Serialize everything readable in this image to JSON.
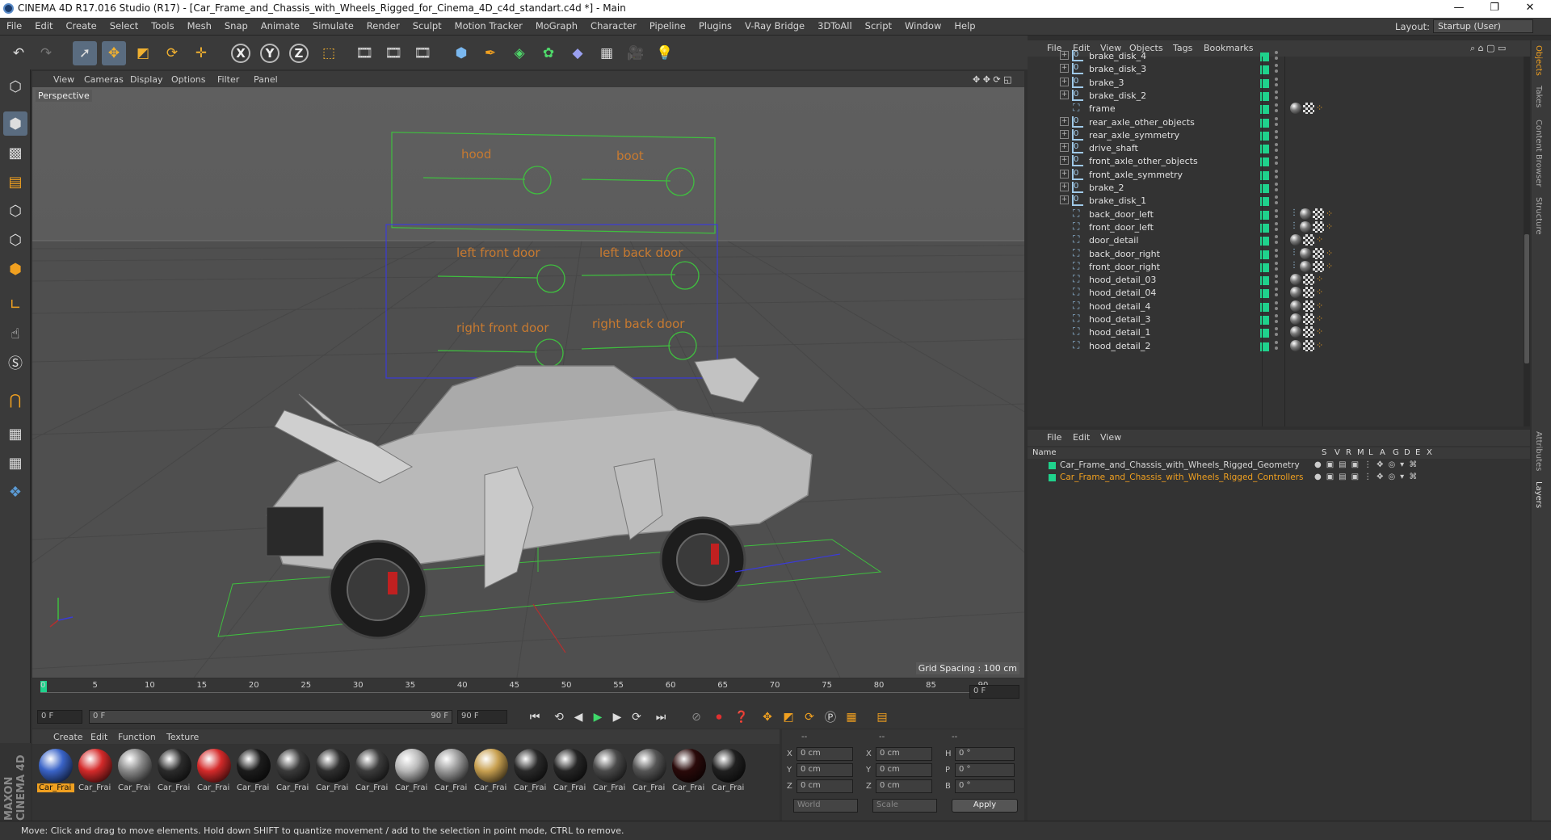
{
  "window": {
    "title": "CINEMA 4D R17.016 Studio (R17) - [Car_Frame_and_Chassis_with_Wheels_Rigged_for_Cinema_4D_c4d_standart.c4d *] - Main",
    "minimize": "—",
    "maximize": "❐",
    "close": "✕"
  },
  "menubar": {
    "items": [
      "File",
      "Edit",
      "Create",
      "Select",
      "Tools",
      "Mesh",
      "Snap",
      "Animate",
      "Simulate",
      "Render",
      "Sculpt",
      "Motion Tracker",
      "MoGraph",
      "Character",
      "Pipeline",
      "Plugins",
      "V-Ray Bridge",
      "3DToAll",
      "Script",
      "Window",
      "Help"
    ],
    "layout_label": "Layout:",
    "layout_value": "Startup (User)"
  },
  "toolbar": {
    "icons": [
      "undo-icon",
      "redo-icon",
      "live-select-icon",
      "move-icon",
      "scale-icon",
      "rotate-icon",
      "transform-icon",
      "x-axis-icon",
      "y-axis-icon",
      "z-axis-icon",
      "coord-system-icon",
      "render-view-icon",
      "render-picture-icon",
      "render-settings-icon",
      "cube-icon",
      "pen-icon",
      "subdivision-icon",
      "cloner-icon",
      "deformer-icon",
      "floor-icon",
      "camera-icon",
      "light-icon"
    ],
    "axis_x": "X",
    "axis_y": "Y",
    "axis_z": "Z"
  },
  "viewport": {
    "menu": [
      "View",
      "Cameras",
      "Display",
      "Options",
      "Filter",
      "Panel"
    ],
    "label": "Perspective",
    "grid_spacing": "Grid Spacing : 100 cm",
    "controller_labels": [
      "hood",
      "boot",
      "left front door",
      "left back door",
      "right front door",
      "right back door"
    ]
  },
  "timeline": {
    "ticks": [
      "0",
      "5",
      "10",
      "15",
      "20",
      "25",
      "30",
      "35",
      "40",
      "45",
      "50",
      "55",
      "60",
      "65",
      "70",
      "75",
      "80",
      "85",
      "90"
    ],
    "current_frame": "0 F",
    "start_field": "0 F",
    "range_start": "0 F",
    "range_end": "90 F",
    "end_field": "90 F"
  },
  "materials": {
    "menu": [
      "Create",
      "Edit",
      "Function",
      "Texture"
    ],
    "items": [
      {
        "label": "Car_Frai",
        "color": "#3a64c8",
        "selected": true
      },
      {
        "label": "Car_Frai",
        "color": "#d42a2a"
      },
      {
        "label": "Car_Frai",
        "color": "#8a8a8a"
      },
      {
        "label": "Car_Frai",
        "color": "#2b2b2b"
      },
      {
        "label": "Car_Frai",
        "color": "#d42a2a"
      },
      {
        "label": "Car_Frai",
        "color": "#1c1c1c"
      },
      {
        "label": "Car_Frai",
        "color": "#3a3a3a"
      },
      {
        "label": "Car_Frai",
        "color": "#2f2f2f"
      },
      {
        "label": "Car_Frai",
        "color": "#3c3c3c"
      },
      {
        "label": "Car_Frai",
        "color": "#b8b8b8"
      },
      {
        "label": "Car_Frai",
        "color": "#9a9a9a"
      },
      {
        "label": "Car_Frai",
        "color": "#c8a050"
      },
      {
        "label": "Car_Frai",
        "color": "#2a2a2a"
      },
      {
        "label": "Car_Frai",
        "color": "#262626"
      },
      {
        "label": "Car_Frai",
        "color": "#4a4a4a"
      },
      {
        "label": "Car_Frai",
        "color": "#555555"
      },
      {
        "label": "Car_Frai",
        "color": "#2a0a0a"
      },
      {
        "label": "Car_Frai",
        "color": "#202020"
      }
    ]
  },
  "coordinates": {
    "headers": [
      "--",
      "--",
      "--"
    ],
    "rows": [
      {
        "a": "X",
        "av": "0 cm",
        "b": "X",
        "bv": "0 cm",
        "c": "H",
        "cv": "0 °"
      },
      {
        "a": "Y",
        "av": "0 cm",
        "b": "Y",
        "bv": "0 cm",
        "c": "P",
        "cv": "0 °"
      },
      {
        "a": "Z",
        "av": "0 cm",
        "b": "Z",
        "bv": "0 cm",
        "c": "B",
        "cv": "0 °"
      }
    ],
    "world": "World",
    "scale": "Scale",
    "apply": "Apply"
  },
  "status": "Move: Click and drag to move elements. Hold down SHIFT to quantize movement / add to the selection in point mode, CTRL to remove.",
  "maxon": "MAXON CINEMA 4D",
  "object_manager": {
    "menu": [
      "File",
      "Edit",
      "View",
      "Objects",
      "Tags",
      "Bookmarks"
    ],
    "rows": [
      {
        "name": "brake_disk_4",
        "type": "null",
        "tags": ""
      },
      {
        "name": "brake_disk_3",
        "type": "null",
        "tags": ""
      },
      {
        "name": "brake_3",
        "type": "null",
        "tags": ""
      },
      {
        "name": "brake_disk_2",
        "type": "null",
        "tags": ""
      },
      {
        "name": "frame",
        "type": "joint",
        "tags": "mat-chk-ik"
      },
      {
        "name": "rear_axle_other_objects",
        "type": "null",
        "tags": ""
      },
      {
        "name": "rear_axle_symmetry",
        "type": "null",
        "tags": ""
      },
      {
        "name": "drive_shaft",
        "type": "null",
        "tags": ""
      },
      {
        "name": "front_axle_other_objects",
        "type": "null",
        "tags": ""
      },
      {
        "name": "front_axle_symmetry",
        "type": "null",
        "tags": ""
      },
      {
        "name": "brake_2",
        "type": "null",
        "tags": ""
      },
      {
        "name": "brake_disk_1",
        "type": "null",
        "tags": ""
      },
      {
        "name": "back_door_left",
        "type": "joint",
        "tags": "dot-mat-chk-ik"
      },
      {
        "name": "front_door_left",
        "type": "joint",
        "tags": "dot-mat-chk-ik"
      },
      {
        "name": "door_detail",
        "type": "joint",
        "tags": "mat-chk-ik"
      },
      {
        "name": "back_door_right",
        "type": "joint",
        "tags": "dot-mat-chk-ik"
      },
      {
        "name": "front_door_right",
        "type": "joint",
        "tags": "dot-mat-chk-ik"
      },
      {
        "name": "hood_detail_03",
        "type": "joint",
        "tags": "mat-chk-ik"
      },
      {
        "name": "hood_detail_04",
        "type": "joint",
        "tags": "mat-chk-ik"
      },
      {
        "name": "hood_detail_4",
        "type": "joint",
        "tags": "mat-chk-ik"
      },
      {
        "name": "hood_detail_3",
        "type": "joint",
        "tags": "mat-chk-ik"
      },
      {
        "name": "hood_detail_1",
        "type": "joint",
        "tags": "mat-chk-ik"
      },
      {
        "name": "hood_detail_2",
        "type": "joint",
        "tags": "mat-chk-ik"
      }
    ]
  },
  "layer_manager": {
    "menu": [
      "File",
      "Edit",
      "View"
    ],
    "columns": [
      "Name",
      "S",
      "V",
      "R",
      "M",
      "L",
      "A",
      "G",
      "D",
      "E",
      "X"
    ],
    "layers": [
      {
        "name": "Car_Frame_and_Chassis_with_Wheels_Rigged_Geometry",
        "color": "#d8d8d8"
      },
      {
        "name": "Car_Frame_and_Chassis_with_Wheels_Rigged_Controllers",
        "color": "#f0a020"
      }
    ]
  },
  "side_tabs": [
    "Objects",
    "Takes",
    "Content Browser",
    "Structure",
    "Attributes",
    "Layers"
  ]
}
